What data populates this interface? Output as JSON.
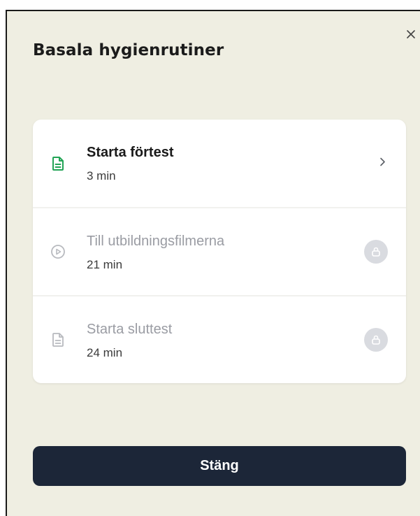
{
  "dialog": {
    "title": "Basala hygienrutiner",
    "close_icon": "close-icon"
  },
  "items": [
    {
      "label": "Starta förtest",
      "duration": "3 min",
      "icon": "document-icon",
      "icon_color": "#22A455",
      "trailing": "chevron-right-icon",
      "locked": false
    },
    {
      "label": "Till utbildningsfilmerna",
      "duration": "21 min",
      "icon": "play-circle-icon",
      "icon_color": "#B8BABF",
      "trailing": "lock-icon",
      "locked": true
    },
    {
      "label": "Starta sluttest",
      "duration": "24 min",
      "icon": "document-icon",
      "icon_color": "#B8BABF",
      "trailing": "lock-icon",
      "locked": true
    }
  ],
  "footer": {
    "close_button_label": "Stäng"
  },
  "colors": {
    "background": "#EFEEE2",
    "primary_button": "#1C2638",
    "accent_green": "#22A455",
    "locked_text": "#9A9CA3"
  }
}
